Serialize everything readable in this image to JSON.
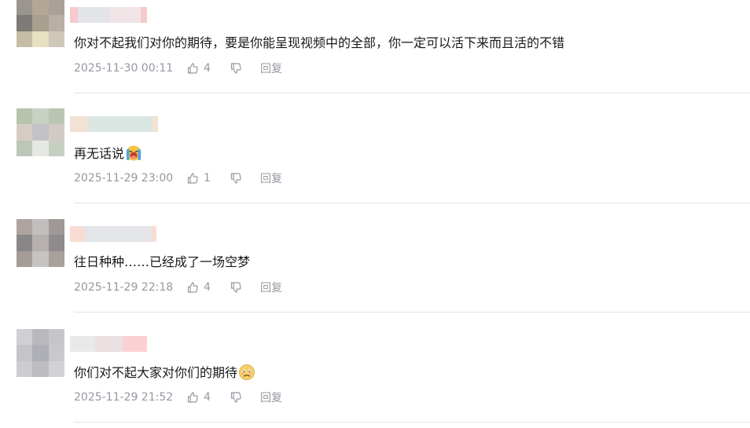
{
  "colors": {
    "text": "#18191c",
    "meta": "#9499a0",
    "divider": "#e3e5e7"
  },
  "comments": [
    {
      "text": "你对不起我们对你的期待，要是你能呈现视频中的全部，你一定可以活下来而且活的不错",
      "emoji": "",
      "time": "2025-11-30 00:11",
      "likes": "4",
      "reply_label": "回复"
    },
    {
      "text": "再无话说",
      "emoji": "crying-emoji",
      "time": "2025-11-29 23:00",
      "likes": "1",
      "reply_label": "回复"
    },
    {
      "text": "往日种种……已经成了一场空梦",
      "emoji": "",
      "time": "2025-11-29 22:18",
      "likes": "4",
      "reply_label": "回复"
    },
    {
      "text": "你们对不起大家对你们的期待",
      "emoji": "sad-face-emoji",
      "time": "2025-11-29 21:52",
      "likes": "4",
      "reply_label": "回复"
    }
  ]
}
